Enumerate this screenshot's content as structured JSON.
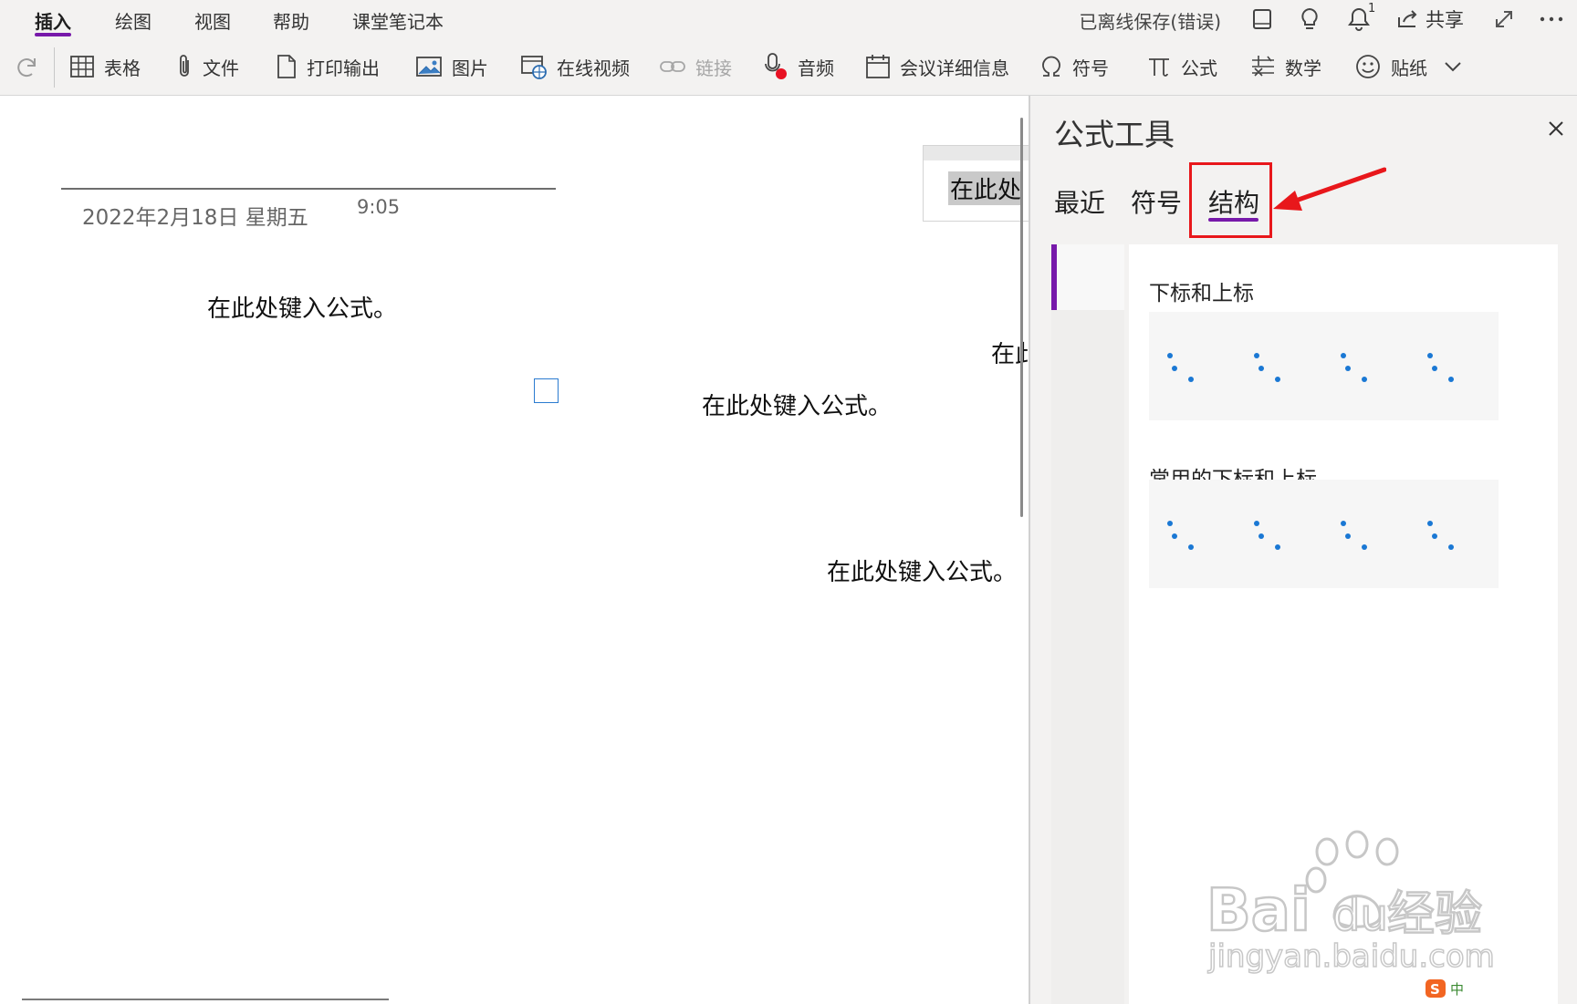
{
  "menu_tabs": [
    "插入",
    "绘图",
    "视图",
    "帮助",
    "课堂笔记本"
  ],
  "status": "已离线保存(错误)",
  "notification_count": "1",
  "share_label": "共享",
  "toolbar": {
    "table": "表格",
    "file": "文件",
    "printout": "打印输出",
    "picture": "图片",
    "online_video": "在线视频",
    "link": "链接",
    "audio": "音频",
    "meeting_details": "会议详细信息",
    "symbol": "符号",
    "equation": "公式",
    "math": "数学",
    "sticker": "贴纸"
  },
  "page": {
    "date": "2022年2月18日 星期五",
    "time": "9:05",
    "equation_placeholder": "在此处键入公式。",
    "selected_fragment": "在此处",
    "clipped_fragment": "在此"
  },
  "pane": {
    "title": "公式工具",
    "tabs": [
      "最近",
      "符号",
      "结构"
    ],
    "active_tab": "结构",
    "sections": [
      {
        "title": "下标和上标",
        "tile_count": 4
      },
      {
        "title": "常用的下标和上标",
        "tile_count": 4
      }
    ]
  },
  "colors": {
    "accent": "#7719aa",
    "annotation_red": "#e8171b",
    "placeholder_dot": "#1a78d4"
  },
  "watermark": {
    "brand": "Bai",
    "brand_tail": "du",
    "brand_suffix": "经验",
    "url": "jingyan.baidu.com"
  },
  "ime_indicator": "中"
}
